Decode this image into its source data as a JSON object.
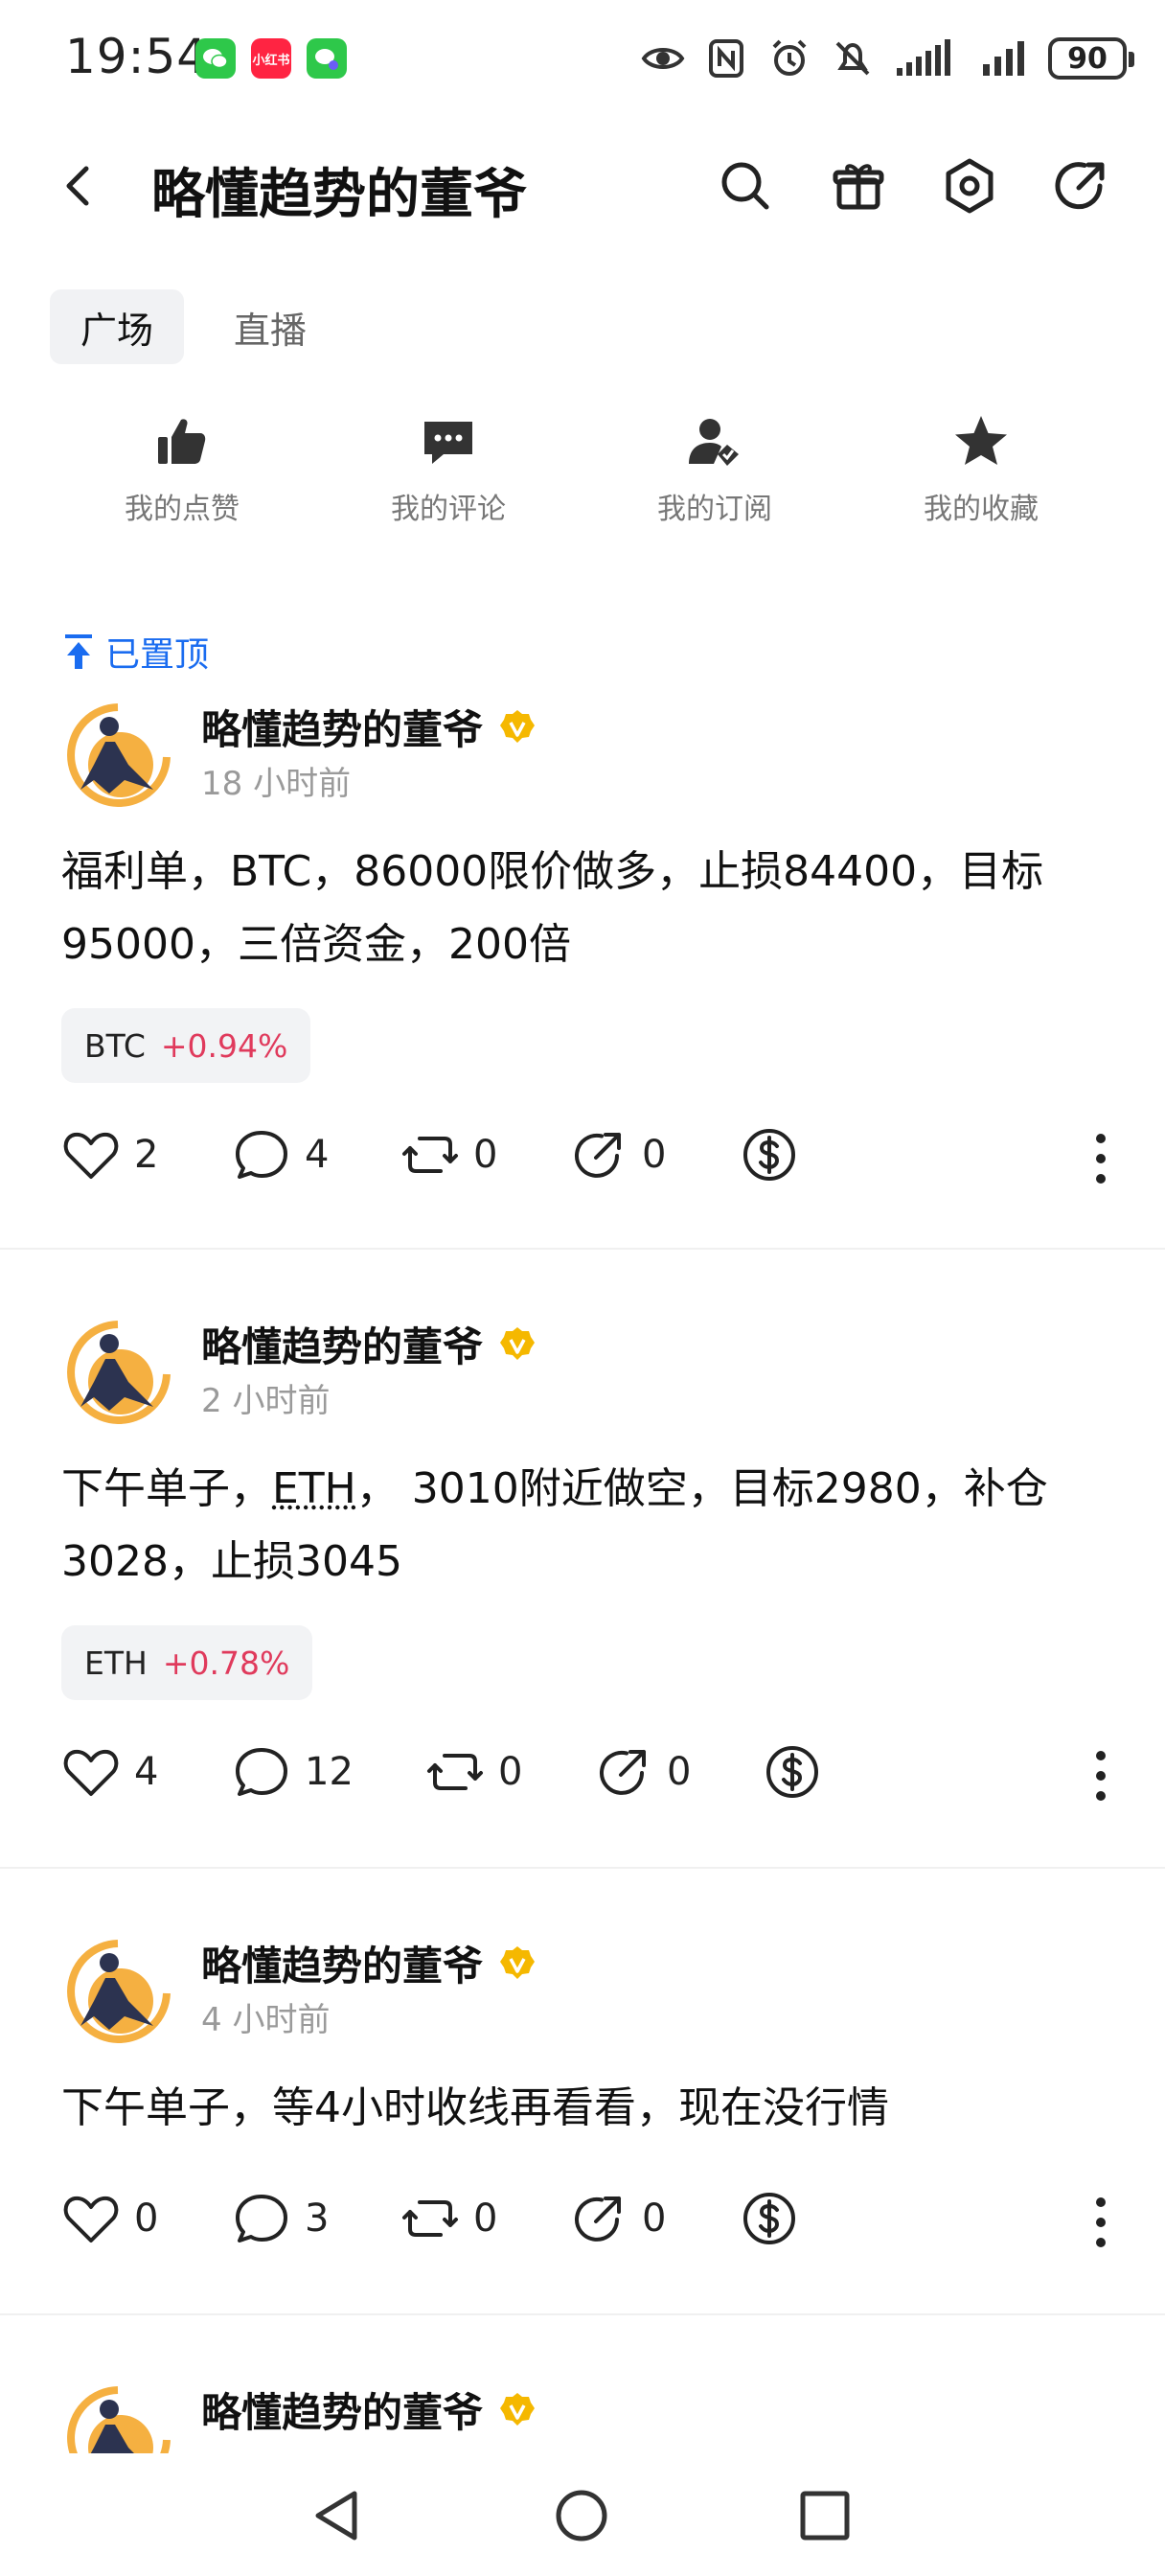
{
  "status_bar": {
    "time": "19:54",
    "apps": [
      {
        "name": "wechat-icon",
        "color": "#2ec84a",
        "label": ""
      },
      {
        "name": "xiaohongshu-icon",
        "color": "#ff2442",
        "label": "小红书"
      },
      {
        "name": "wechat-pay-icon",
        "color": "#2ec84a",
        "label": ""
      }
    ],
    "battery": "90"
  },
  "header": {
    "title": "略懂趋势的董爷"
  },
  "tabs": [
    {
      "label": "广场",
      "active": true
    },
    {
      "label": "直播",
      "active": false
    }
  ],
  "shortcuts": [
    {
      "label": "我的点赞",
      "icon": "thumbs-up-icon"
    },
    {
      "label": "我的评论",
      "icon": "comment-icon"
    },
    {
      "label": "我的订阅",
      "icon": "subscribe-icon"
    },
    {
      "label": "我的收藏",
      "icon": "star-icon"
    }
  ],
  "pinned_label": "已置顶",
  "posts": [
    {
      "author": "略懂趋势的董爷",
      "time": "18 小时前",
      "content": "福利单，BTC，86000限价做多，止损84400，目标95000，三倍资金，200倍",
      "ticker": {
        "symbol": "BTC",
        "change": "+0.94%"
      },
      "likes": "2",
      "comments": "4",
      "reposts": "0",
      "shares": "0"
    },
    {
      "author": "略懂趋势的董爷",
      "time": "2 小时前",
      "content_pre": "下午单子，",
      "content_link": "ETH",
      "content_post": "， 3010附近做空，目标2980，补仓3028，止损3045",
      "ticker": {
        "symbol": "ETH",
        "change": "+0.78%"
      },
      "likes": "4",
      "comments": "12",
      "reposts": "0",
      "shares": "0"
    },
    {
      "author": "略懂趋势的董爷",
      "time": "4 小时前",
      "content": "下午单子，等4小时收线再看看，现在没行情",
      "likes": "0",
      "comments": "3",
      "reposts": "0",
      "shares": "0"
    },
    {
      "author": "略懂趋势的董爷"
    }
  ],
  "colors": {
    "accent_blue": "#1a6cf0",
    "price_up": "#e03a5c",
    "verified_gold": "#f5b800"
  }
}
